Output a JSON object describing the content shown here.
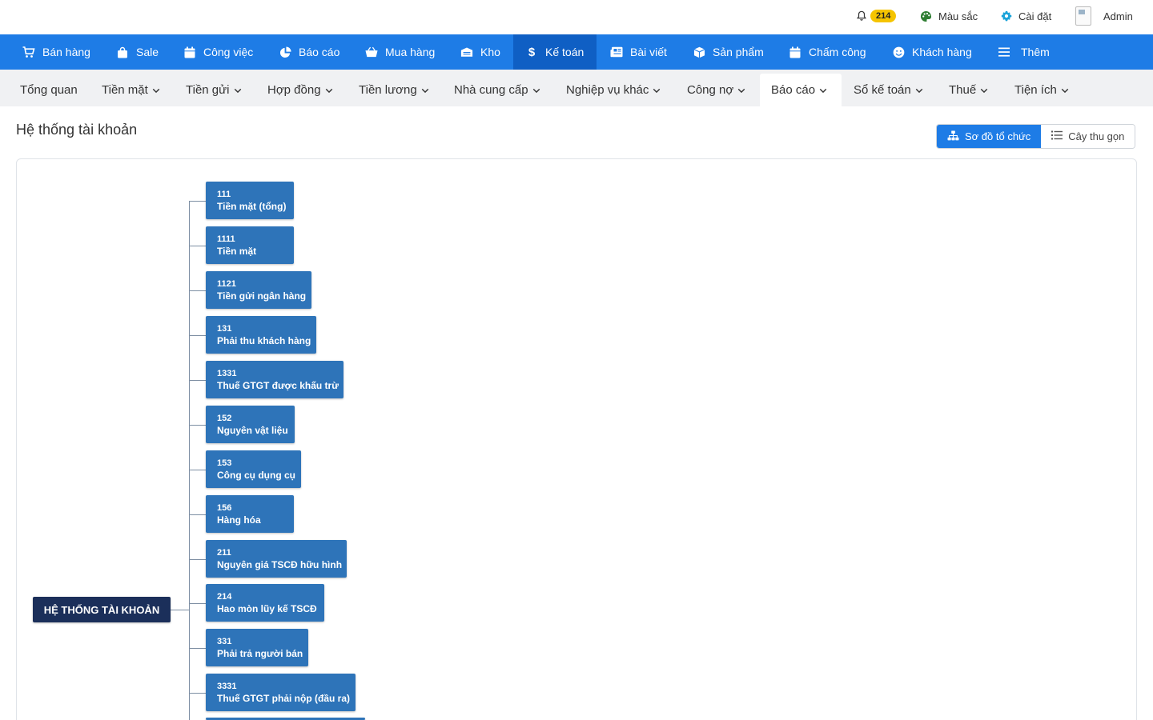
{
  "topbar": {
    "notification_count": "214",
    "color_label": "Màu sắc",
    "settings_label": "Cài đặt",
    "avatar_alt": "la...",
    "user_label": "Admin"
  },
  "main_nav": [
    {
      "label": "Bán hàng",
      "icon": "cart-icon"
    },
    {
      "label": "Sale",
      "icon": "bag-icon"
    },
    {
      "label": "Công việc",
      "icon": "calendar-icon"
    },
    {
      "label": "Báo cáo",
      "icon": "pie-chart-icon"
    },
    {
      "label": "Mua hàng",
      "icon": "basket-icon"
    },
    {
      "label": "Kho",
      "icon": "warehouse-icon"
    },
    {
      "label": "Kế toán",
      "icon": "dollar-icon",
      "active": true
    },
    {
      "label": "Bài viết",
      "icon": "newspaper-icon"
    },
    {
      "label": "Sản phẩm",
      "icon": "box-icon"
    },
    {
      "label": "Chấm công",
      "icon": "calendar-icon"
    },
    {
      "label": "Khách hàng",
      "icon": "smile-icon"
    },
    {
      "label": "Thêm",
      "icon": "menu-icon"
    }
  ],
  "sub_nav": [
    {
      "label": "Tổng quan",
      "dropdown": false
    },
    {
      "label": "Tiền mặt",
      "dropdown": true
    },
    {
      "label": "Tiền gửi",
      "dropdown": true
    },
    {
      "label": "Hợp đồng",
      "dropdown": true
    },
    {
      "label": "Tiền lương",
      "dropdown": true
    },
    {
      "label": "Nhà cung cấp",
      "dropdown": true
    },
    {
      "label": "Nghiệp vụ khác",
      "dropdown": true
    },
    {
      "label": "Công nợ",
      "dropdown": true
    },
    {
      "label": "Báo cáo",
      "dropdown": true,
      "active": true
    },
    {
      "label": "Sổ kế toán",
      "dropdown": true
    },
    {
      "label": "Thuế",
      "dropdown": true
    },
    {
      "label": "Tiện ích",
      "dropdown": true
    }
  ],
  "page": {
    "title": "Hệ thống tài khoản"
  },
  "view_toggle": {
    "org_chart_label": "Sơ đồ tổ chức",
    "collapsed_tree_label": "Cây thu gọn"
  },
  "tree": {
    "root_label": "HỆ THỐNG TÀI KHOẢN",
    "accounts": [
      {
        "code": "111",
        "name": "Tiền mặt (tổng)"
      },
      {
        "code": "1111",
        "name": "Tiền mặt"
      },
      {
        "code": "1121",
        "name": "Tiền gửi ngân hàng"
      },
      {
        "code": "131",
        "name": "Phải thu khách hàng"
      },
      {
        "code": "1331",
        "name": "Thuế GTGT được khấu trừ"
      },
      {
        "code": "152",
        "name": "Nguyên vật liệu"
      },
      {
        "code": "153",
        "name": "Công cụ dụng cụ"
      },
      {
        "code": "156",
        "name": "Hàng hóa"
      },
      {
        "code": "211",
        "name": "Nguyên giá TSCĐ hữu hình"
      },
      {
        "code": "214",
        "name": "Hao mòn lũy kế TSCĐ"
      },
      {
        "code": "331",
        "name": "Phải trả người bán"
      },
      {
        "code": "3331",
        "name": "Thuế GTGT phải nộp (đầu ra)"
      }
    ]
  },
  "colors": {
    "primary": "#1e7ce6",
    "primary_active": "#0f5fc4",
    "node": "#2e74b9",
    "root_node": "#1b2f5a",
    "badge": "#f5c400"
  }
}
